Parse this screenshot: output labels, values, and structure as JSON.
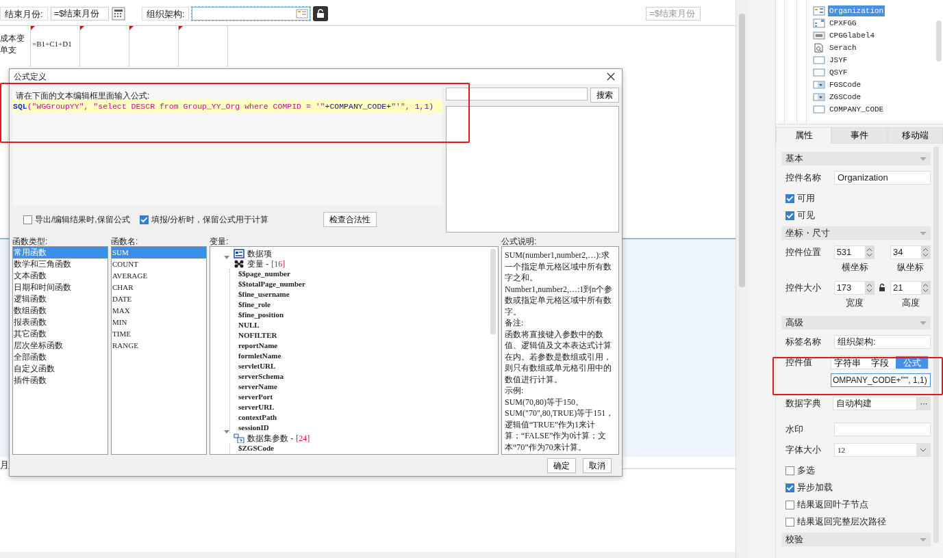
{
  "report": {
    "end_month_label": "结束月份:",
    "end_month_value": "=$结束月份",
    "org_label": "组织架构:",
    "right_field_value": "=$结束月份",
    "header_cell_lines": [
      "成本变",
      "单支"
    ],
    "formula_cell": "=B1+C1+D1",
    "bottom_fragment": "月"
  },
  "dialog": {
    "title": "公式定义",
    "prompt": "请在下面的文本编辑框里面输入公式:",
    "formula_tokens": [
      {
        "kind": "function",
        "text": "SQL"
      },
      {
        "kind": "string",
        "text": "(\"WGGroupYY\", \"select DESCR from Group_YY_Org where COMPID = '\""
      },
      {
        "kind": "identifier",
        "text": "+COMPANY_CODE+"
      },
      {
        "kind": "string",
        "text": "\"'\", "
      },
      {
        "kind": "number",
        "text": "1,1)"
      }
    ],
    "search_button": "搜索",
    "options": [
      {
        "label": "导出/编辑结果时,保留公式",
        "checked": false
      },
      {
        "label": "填报/分析时，保留公式用于计算",
        "checked": true
      }
    ],
    "check_button": "检查合法性",
    "function_types": {
      "label": "函数类型:",
      "items": [
        {
          "text": "常用函数",
          "selected": true
        },
        {
          "text": "数学和三角函数",
          "selected": false
        },
        {
          "text": "文本函数",
          "selected": false
        },
        {
          "text": "日期和时间函数",
          "selected": false
        },
        {
          "text": "逻辑函数",
          "selected": false
        },
        {
          "text": "数组函数",
          "selected": false
        },
        {
          "text": "报表函数",
          "selected": false
        },
        {
          "text": "其它函数",
          "selected": false
        },
        {
          "text": "层次坐标函数",
          "selected": false
        },
        {
          "text": "全部函数",
          "selected": false
        },
        {
          "text": "自定义函数",
          "selected": false
        },
        {
          "text": "插件函数",
          "selected": false
        }
      ]
    },
    "function_names": {
      "label": "函数名:",
      "items": [
        {
          "text": "SUM",
          "selected": true
        },
        {
          "text": "COUNT",
          "selected": false
        },
        {
          "text": "AVERAGE",
          "selected": false
        },
        {
          "text": "CHAR",
          "selected": false
        },
        {
          "text": "DATE",
          "selected": false
        },
        {
          "text": "MAX",
          "selected": false
        },
        {
          "text": "MIN",
          "selected": false
        },
        {
          "text": "TIME",
          "selected": false
        },
        {
          "text": "RANGE",
          "selected": false
        }
      ]
    },
    "variables": {
      "label": "变量:",
      "items": [
        {
          "text": "数据项",
          "kind": "dataitem"
        },
        {
          "text": "变量 -",
          "count": "[16]",
          "kind": "variables",
          "expanded": true,
          "children": [
            {
              "text": "$$page_number"
            },
            {
              "text": "$$totalPage_number"
            },
            {
              "text": "$fine_username"
            },
            {
              "text": "$fine_role"
            },
            {
              "text": "$fine_position"
            },
            {
              "text": "NULL"
            },
            {
              "text": "NOFILTER"
            },
            {
              "text": "reportName"
            },
            {
              "text": "formletName"
            },
            {
              "text": "servletURL"
            },
            {
              "text": "serverSchema"
            },
            {
              "text": "serverName"
            },
            {
              "text": "serverPort"
            },
            {
              "text": "serverURL"
            },
            {
              "text": "contextPath"
            },
            {
              "text": "sessionID"
            }
          ]
        },
        {
          "text": "数据集参数 -",
          "count": "[24]",
          "kind": "dataset",
          "expanded": true,
          "children": [
            {
              "text": "$ZGSCode"
            }
          ]
        }
      ]
    },
    "description": {
      "label": "公式说明:",
      "paragraphs": [
        "SUM(number1,number2,…):求一个指定单元格区域中所有数字之和。",
        "Number1,number2,…:1到n个参数或指定单元格区域中所有数字。",
        "备注:",
        "函数将直接键入参数中的数值、逻辑值及文本表达式计算在内。若参数是数组或引用，则只有数组或单元格引用中的数值进行计算。",
        "示例:",
        "SUM(70,80)等于150。",
        "SUM(\"70\",80,TRUE)等于151，逻辑值“TRUE”作为1来计算；“FALSE”作为0计算；文本“70”作为70来计算。"
      ]
    },
    "ok_button": "确定",
    "cancel_button": "取消"
  },
  "widget_tree": [
    {
      "text": "Organization",
      "kind": "treecombo",
      "selected": true
    },
    {
      "text": "CPXFGG",
      "kind": "list",
      "selected": false
    },
    {
      "text": "CPGGlabel4",
      "kind": "label",
      "selected": false
    },
    {
      "text": "Serach",
      "kind": "search",
      "selected": false
    },
    {
      "text": "JSYF",
      "kind": "textbox",
      "selected": false
    },
    {
      "text": "QSYF",
      "kind": "textbox",
      "selected": false
    },
    {
      "text": "FGSCode",
      "kind": "combo",
      "selected": false
    },
    {
      "text": "ZGSCode",
      "kind": "combo",
      "selected": false
    },
    {
      "text": "COMPANY_CODE",
      "kind": "textbox",
      "selected": false
    }
  ],
  "panel_tabs": [
    {
      "label": "属性",
      "selected": true
    },
    {
      "label": "事件",
      "selected": false
    },
    {
      "label": "移动端",
      "selected": false
    }
  ],
  "properties": [
    {
      "kind": "section",
      "label": "基本"
    },
    {
      "kind": "text",
      "label": "控件名称",
      "value": "Organization"
    },
    {
      "kind": "checkbox",
      "label": "可用",
      "checked": true
    },
    {
      "kind": "checkbox",
      "label": "可见",
      "checked": true
    },
    {
      "kind": "section",
      "label": "坐标・尺寸"
    },
    {
      "kind": "pair",
      "label": "控件位置",
      "lock": false,
      "first": {
        "value": "531",
        "caption": "横坐标"
      },
      "second": {
        "value": "34",
        "caption": "纵坐标"
      }
    },
    {
      "kind": "pair",
      "label": "控件大小",
      "lock": true,
      "first": {
        "value": "173",
        "caption": "宽度"
      },
      "second": {
        "value": "21",
        "caption": "高度"
      }
    },
    {
      "kind": "section",
      "label": "高级"
    },
    {
      "kind": "text",
      "label": "标签名称",
      "value": "组织架构:"
    },
    {
      "kind": "segmented",
      "label": "控件值",
      "options": [
        {
          "label": "字符串",
          "selected": false
        },
        {
          "label": "字段",
          "selected": false
        },
        {
          "label": "公式",
          "selected": true
        }
      ],
      "value": "OMPANY_CODE+\"'\", 1,1)"
    },
    {
      "kind": "dict",
      "label": "数据字典",
      "value": "自动构建",
      "button": "···"
    },
    {
      "kind": "text",
      "label": "水印"
    },
    {
      "kind": "select",
      "label": "字体大小",
      "value": "12"
    },
    {
      "kind": "checkbox",
      "label": "多选",
      "checked": false
    },
    {
      "kind": "checkbox",
      "label": "异步加载",
      "checked": true
    },
    {
      "kind": "checkbox",
      "label": "结果返回叶子节点",
      "checked": false
    },
    {
      "kind": "checkbox",
      "label": "结果返回完整层次路径",
      "checked": false
    },
    {
      "kind": "section",
      "label": "校验"
    }
  ]
}
